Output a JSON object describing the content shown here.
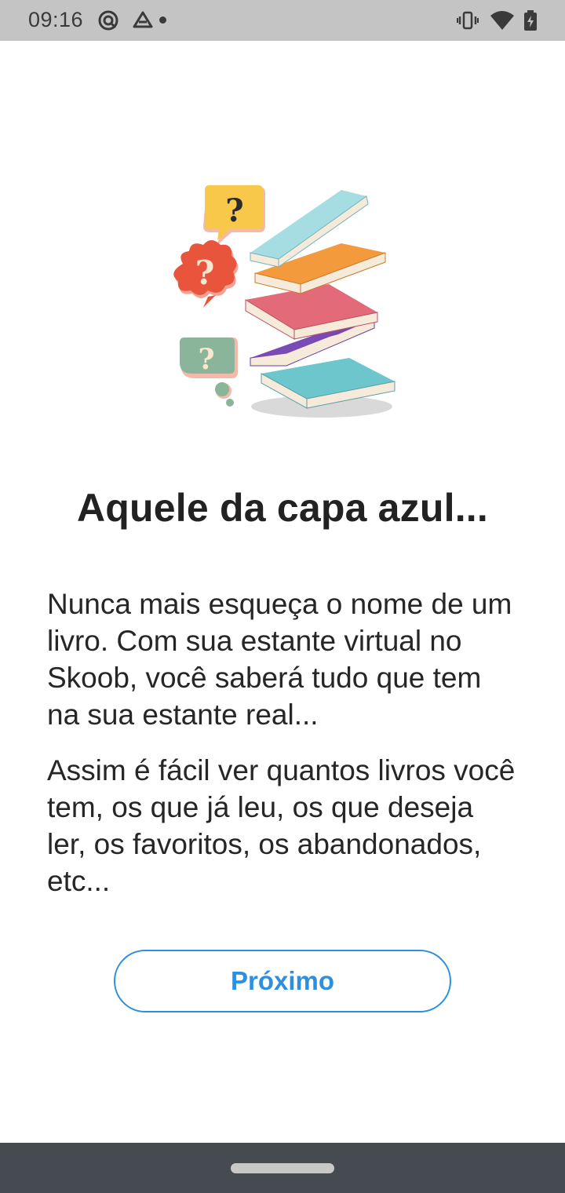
{
  "status_bar": {
    "time": "09:16",
    "icons": [
      "data-saver-icon",
      "drive-icon",
      "notification-dot",
      "vibrate-icon",
      "wifi-icon",
      "battery-charging-icon"
    ]
  },
  "onboarding": {
    "illustration": "books-question-marks-illustration",
    "title": "Aquele da capa azul...",
    "paragraph_1": "Nunca mais esqueça o nome de um livro. Com sua estante virtual no Skoob, você saberá tudo que tem na sua estante real...",
    "paragraph_2": "Assim é fácil ver quantos livros você tem, os que já leu, os que deseja ler, os favoritos, os abandonados, etc...",
    "next_label": "Próximo"
  },
  "colors": {
    "accent": "#2d8fe0",
    "text": "#262626",
    "status_bar_bg": "#c4c4c4",
    "nav_bar_bg": "#464b52"
  }
}
